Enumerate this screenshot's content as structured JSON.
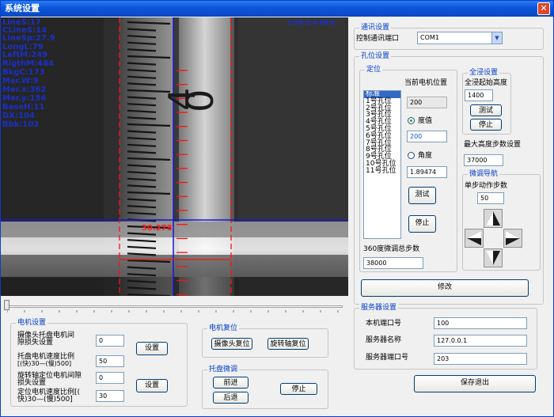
{
  "window": {
    "title": "系统设置",
    "close_glyph": "✕"
  },
  "overlay": {
    "left_lines": [
      "LineS:17",
      "CLineS:14",
      "LineSp:27.9",
      "LongL:79",
      "LeftM:249",
      "RigthM:484",
      "BkgC:173",
      "Mer.W:9",
      "Mer.x:362",
      "Mer.y:156",
      "BaseH:11",
      "DX:104",
      "Bbk:102"
    ],
    "top_right": "1:08:2:4:88:E",
    "measure": "30.278",
    "scale_digits": [
      "4",
      "0"
    ]
  },
  "comm": {
    "title": "通讯设置",
    "port_label": "控制通讯端口",
    "port_value": "COM1"
  },
  "hole": {
    "title": "孔位设置",
    "position": {
      "title": "定位",
      "current_label": "当前电机位置",
      "current_value": "200",
      "list": [
        "标准",
        "1号孔位",
        "2号孔位",
        "3号孔位",
        "4号孔位",
        "5号孔位",
        "6号孔位",
        "7号孔位",
        "8号孔位",
        "9号孔位",
        "10号孔位",
        "11号孔位"
      ],
      "degree_label": "度值",
      "degree_value": "200",
      "angle_label": "角度",
      "angle_value": "1.89474",
      "test_label": "测试",
      "stop_label": "停止",
      "total_label": "360度微调总步数",
      "total_value": "38000"
    },
    "dip": {
      "title": "全浸设置",
      "start_label": "全浸起始高度",
      "start_value": "1400",
      "test_label": "测试",
      "stop_label": "停止"
    },
    "max_label": "最大高度步数设置",
    "max_value": "37000",
    "nav": {
      "title": "微调导航",
      "step_label": "单步动作步数",
      "step_value": "50"
    },
    "modify_label": "修改"
  },
  "server": {
    "title": "服务器设置",
    "local_port_label": "本机端口号",
    "local_port_value": "100",
    "name_label": "服务器名称",
    "name_value": "127.0.0.1",
    "port_label": "服务器端口号",
    "port_value": "203"
  },
  "save_label": "保存退出",
  "motor": {
    "title": "电机设置",
    "cam_gap_label1": "摄像头托盘电机间",
    "cam_gap_label2": "隙损失设置",
    "cam_gap_value": "0",
    "tray_speed_label1": "托盘电机速度比例",
    "tray_speed_label2": "[(快)30—(慢)500]",
    "tray_speed_value": "50",
    "set1_label": "设置",
    "rot_gap_label1": "旋转轴定位电机间隙",
    "rot_gap_label2": "损失设置",
    "rot_gap_value": "0",
    "pos_speed_label1": "定位电机速度比例[(",
    "pos_speed_label2": "快)30—(慢)500]",
    "pos_speed_value": "30",
    "set2_label": "设置"
  },
  "reset": {
    "title": "电机复位",
    "cam_label": "摄像头复位",
    "rot_label": "旋转轴复位"
  },
  "tray": {
    "title": "托盘微调",
    "forward_label": "前进",
    "back_label": "后退",
    "stop_label": "停止"
  }
}
